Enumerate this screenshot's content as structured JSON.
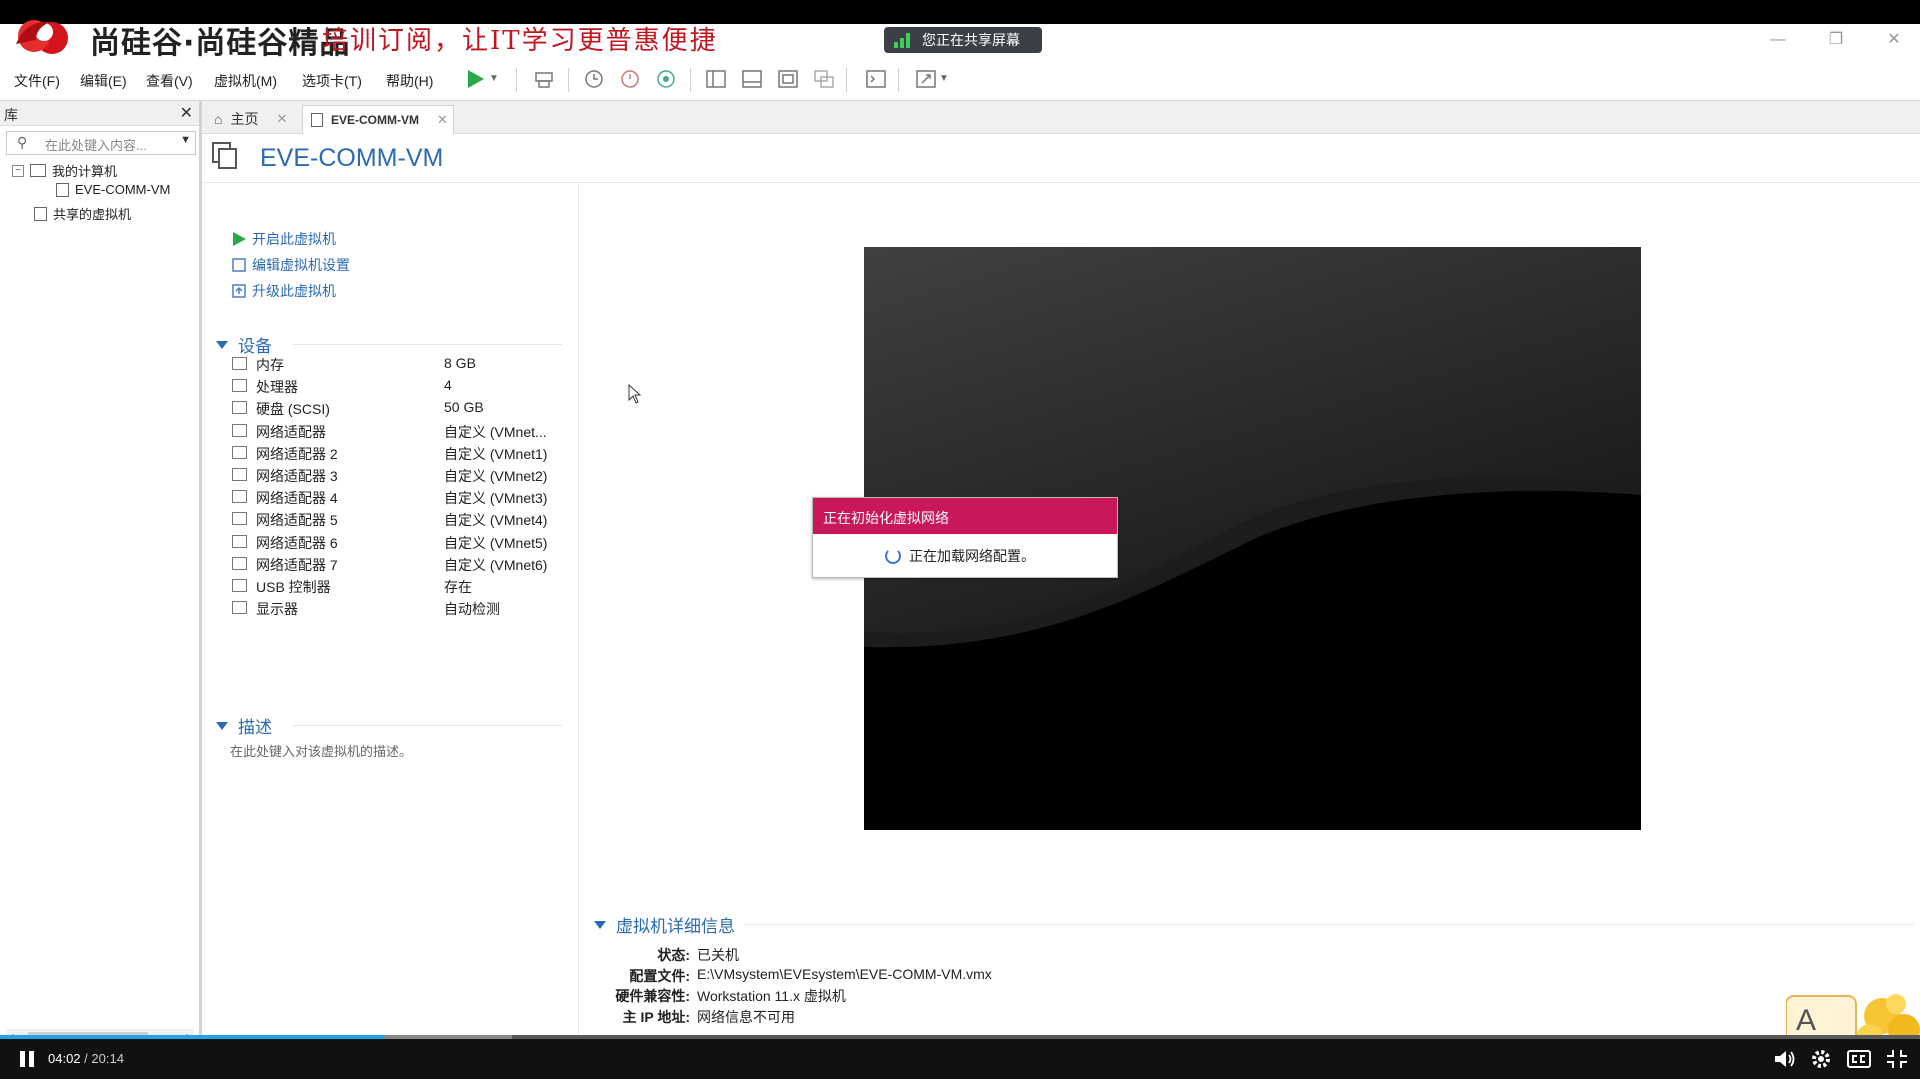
{
  "brand": {
    "name": "尚硅谷·尚硅谷精品",
    "slogan": "培训订阅，让IT学习更普惠便捷",
    "logo": "swirl-logo-icon"
  },
  "screen_share": {
    "label": "您正在共享屏幕"
  },
  "menu": [
    "文件(F)",
    "编辑(E)",
    "查看(V)",
    "虚拟机(M)",
    "选项卡(T)",
    "帮助(H)"
  ],
  "library": {
    "title": "库",
    "search_placeholder": "在此处键入内容...",
    "tree": [
      {
        "label": "我的计算机"
      },
      {
        "label": "EVE-COMM-VM"
      },
      {
        "label": "共享的虚拟机"
      }
    ]
  },
  "tabs": [
    {
      "label": "主页"
    },
    {
      "label": "EVE-COMM-VM"
    }
  ],
  "vm": {
    "title": "EVE-COMM-VM",
    "actions": [
      "开启此虚拟机",
      "编辑虚拟机设置",
      "升级此虚拟机"
    ],
    "devices_title": "设备",
    "devices": [
      {
        "name": "内存",
        "value": "8 GB"
      },
      {
        "name": "处理器",
        "value": "4"
      },
      {
        "name": "硬盘 (SCSI)",
        "value": "50 GB"
      },
      {
        "name": "网络适配器",
        "value": "自定义 (VMnet..."
      },
      {
        "name": "网络适配器 2",
        "value": "自定义 (VMnet1)"
      },
      {
        "name": "网络适配器 3",
        "value": "自定义 (VMnet2)"
      },
      {
        "name": "网络适配器 4",
        "value": "自定义 (VMnet3)"
      },
      {
        "name": "网络适配器 5",
        "value": "自定义 (VMnet4)"
      },
      {
        "name": "网络适配器 6",
        "value": "自定义 (VMnet5)"
      },
      {
        "name": "网络适配器 7",
        "value": "自定义 (VMnet6)"
      },
      {
        "name": "USB 控制器",
        "value": "存在"
      },
      {
        "name": "显示器",
        "value": "自动检测"
      }
    ],
    "description_title": "描述",
    "description_placeholder": "在此处键入对该虚拟机的描述。"
  },
  "dialog": {
    "title": "正在初始化虚拟网络",
    "message": "正在加载网络配置。"
  },
  "details": {
    "title": "虚拟机详细信息",
    "rows": [
      {
        "key": "状态:",
        "value": "已关机"
      },
      {
        "key": "配置文件:",
        "value": "E:\\VMsystem\\EVEsystem\\EVE-COMM-VM.vmx"
      },
      {
        "key": "硬件兼容性:",
        "value": "Workstation 11.x 虚拟机"
      },
      {
        "key": "主 IP 地址:",
        "value": "网络信息不可用"
      }
    ]
  },
  "video": {
    "current_time": "04:02",
    "total_time": "20:14",
    "progress": 0.2
  },
  "colors": {
    "accent_blue": "#2b6bb3",
    "dialog_header": "#c8175a",
    "progress": "#22a3e3",
    "brand_red": "#c0161f"
  }
}
